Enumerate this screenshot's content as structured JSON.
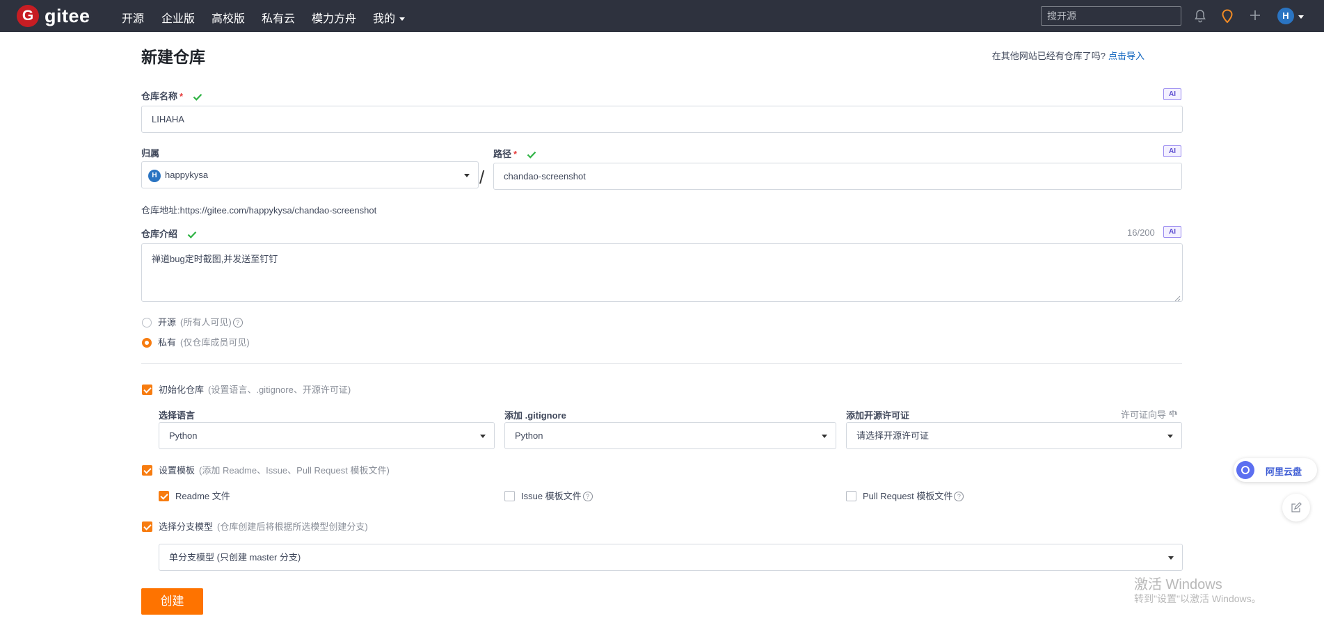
{
  "nav": {
    "logo_letter": "G",
    "logo_text": "gitee",
    "items": [
      "开源",
      "企业版",
      "高校版",
      "私有云",
      "模力方舟",
      "我的"
    ],
    "search_placeholder": "搜开源",
    "avatar_letter": "H"
  },
  "page": {
    "title": "新建仓库",
    "import_question": "在其他网站已经有仓库了吗?",
    "import_link": "点击导入"
  },
  "form": {
    "ai_badge": "AI",
    "required_mark": "*",
    "repo_name": {
      "label": "仓库名称",
      "value": "LIHAHA"
    },
    "owner": {
      "label": "归属",
      "avatar_letter": "H",
      "value": "happykysa"
    },
    "slash": "/",
    "path": {
      "label": "路径",
      "value": "chandao-screenshot"
    },
    "repo_address": {
      "label": "仓库地址:",
      "value": "https://gitee.com/happykysa/chandao-screenshot"
    },
    "intro": {
      "label": "仓库介绍",
      "counter": "16/200",
      "value": "禅道bug定时截图,并发送至钉钉"
    },
    "visibility": {
      "public_label": "开源",
      "public_hint": "(所有人可见)",
      "private_label": "私有",
      "private_hint": "(仅仓库成员可见)",
      "selected": "private"
    },
    "init": {
      "label": "初始化仓库",
      "hint": "(设置语言、.gitignore、开源许可证)",
      "checked": true,
      "language": {
        "label": "选择语言",
        "value": "Python"
      },
      "gitignore": {
        "label": "添加 .gitignore",
        "value": "Python"
      },
      "license": {
        "label": "添加开源许可证",
        "guide": "许可证向导",
        "value": "请选择开源许可证"
      }
    },
    "template": {
      "label": "设置模板",
      "hint": "(添加 Readme、Issue、Pull Request 模板文件)",
      "checked": true,
      "readme": {
        "label": "Readme 文件",
        "checked": true
      },
      "issue": {
        "label": "Issue 模板文件",
        "checked": false
      },
      "pr": {
        "label": "Pull Request 模板文件",
        "checked": false
      }
    },
    "branch": {
      "label": "选择分支模型",
      "hint": "(仓库创建后将根据所选模型创建分支)",
      "checked": true,
      "value": "单分支模型 (只创建 master 分支)"
    },
    "create_button": "创建"
  },
  "widgets": {
    "aliyun_label": "阿里云盘",
    "activation_title": "激活 Windows",
    "activation_hint": "转到\"设置\"以激活 Windows。"
  },
  "colors": {
    "topbar": "#2e323e",
    "accent": "#fe7300",
    "link": "#0960bd",
    "check_green": "#2fb344"
  }
}
